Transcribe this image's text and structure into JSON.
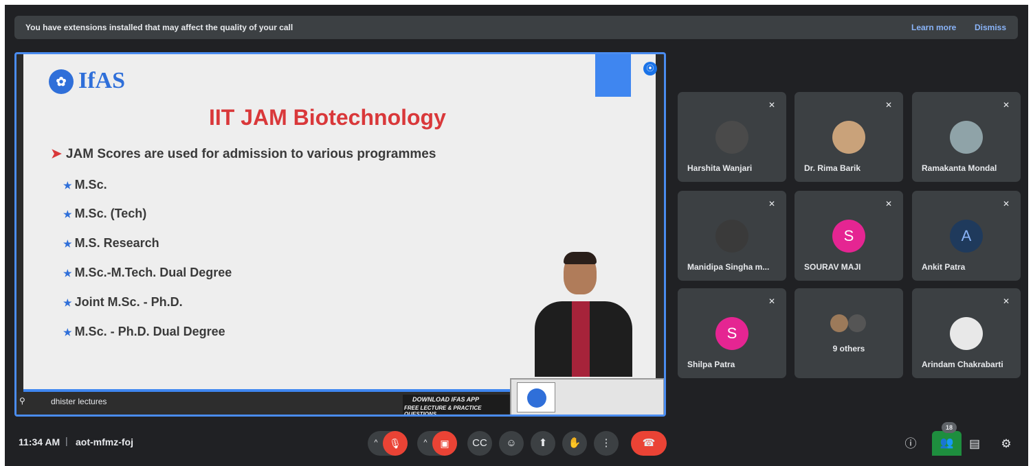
{
  "banner": {
    "message": "You have extensions installed that may affect the quality of your call",
    "learn_more": "Learn more",
    "dismiss": "Dismiss"
  },
  "presentation": {
    "logo_text": "IfAS",
    "title": "IIT JAM Biotechnology",
    "main_bullet": "JAM Scores are used for admission to various programmes",
    "items": [
      "M.Sc.",
      "M.Sc. (Tech)",
      "M.S. Research",
      "M.Sc.-M.Tech. Dual Degree",
      "Joint M.Sc. - Ph.D.",
      "M.Sc. - Ph.D. Dual Degree"
    ],
    "presenter_name": "dhister lectures",
    "download_line1": "DOWNLOAD IFAS APP",
    "download_line2": "FREE LECTURE & PRACTICE QUESTIONS"
  },
  "participants": [
    {
      "name": "Harshita Wanjari",
      "muted": true,
      "avatar": "photo"
    },
    {
      "name": "Dr. Rima Barik",
      "muted": true,
      "avatar": "photo"
    },
    {
      "name": "Ramakanta Mondal",
      "muted": true,
      "avatar": "photo"
    },
    {
      "name": "Manidipa Singha m...",
      "muted": true,
      "avatar": "photo"
    },
    {
      "name": "SOURAV MAJI",
      "muted": true,
      "avatar": "letter",
      "letter": "S"
    },
    {
      "name": "Ankit Patra",
      "muted": true,
      "avatar": "letter",
      "letter": "A"
    },
    {
      "name": "Shilpa Patra",
      "muted": true,
      "avatar": "letter",
      "letter": "S"
    },
    {
      "name": "9 others",
      "muted": false,
      "avatar": "group"
    },
    {
      "name": "Arindam Chakrabarti",
      "muted": true,
      "avatar": "photo"
    }
  ],
  "bottom_bar": {
    "time": "11:34 AM",
    "separator": "|",
    "meeting_code": "aot-mfmz-foj",
    "people_count": "18"
  },
  "colors": {
    "background": "#202124",
    "tile": "#3c4043",
    "accent_blue": "#8ab4f8",
    "end_call_red": "#ea4335",
    "people_active": "#1e8e3e"
  }
}
